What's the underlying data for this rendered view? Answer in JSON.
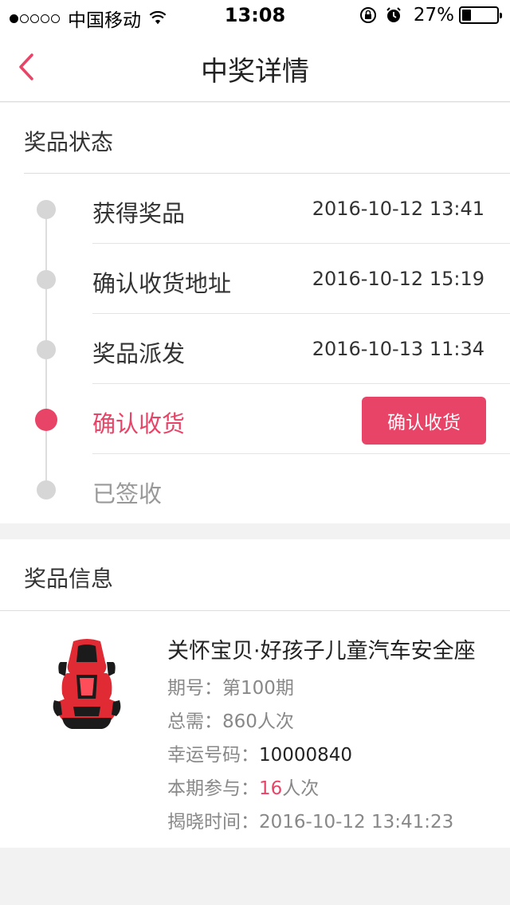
{
  "status_bar": {
    "carrier": "中国移动",
    "time": "13:08",
    "battery_pct": "27%",
    "battery_level": 0.27
  },
  "nav": {
    "title": "中奖详情",
    "back_icon": "chevron-left-icon"
  },
  "status_section": {
    "title": "奖品状态",
    "steps": [
      {
        "label": "获得奖品",
        "time": "2016-10-12 13:41"
      },
      {
        "label": "确认收货地址",
        "time": "2016-10-12 15:19"
      },
      {
        "label": "奖品派发",
        "time": "2016-10-13 11:34"
      },
      {
        "label": "确认收货",
        "button": "确认收货"
      },
      {
        "label": "已签收"
      }
    ]
  },
  "info_section": {
    "title": "奖品信息",
    "product_name": "关怀宝贝·好孩子儿童汽车安全座",
    "period_label": "期号：",
    "period_value": "第100期",
    "total_label": "总需：",
    "total_value": "860人次",
    "lucky_label": "幸运号码：",
    "lucky_value": "10000840",
    "joined_label": "本期参与：",
    "joined_count": "16",
    "joined_unit": "人次",
    "reveal_label": "揭晓时间：",
    "reveal_value": "2016-10-12 13:41:23"
  },
  "colors": {
    "accent": "#e84467",
    "background": "#f2f2f2"
  }
}
